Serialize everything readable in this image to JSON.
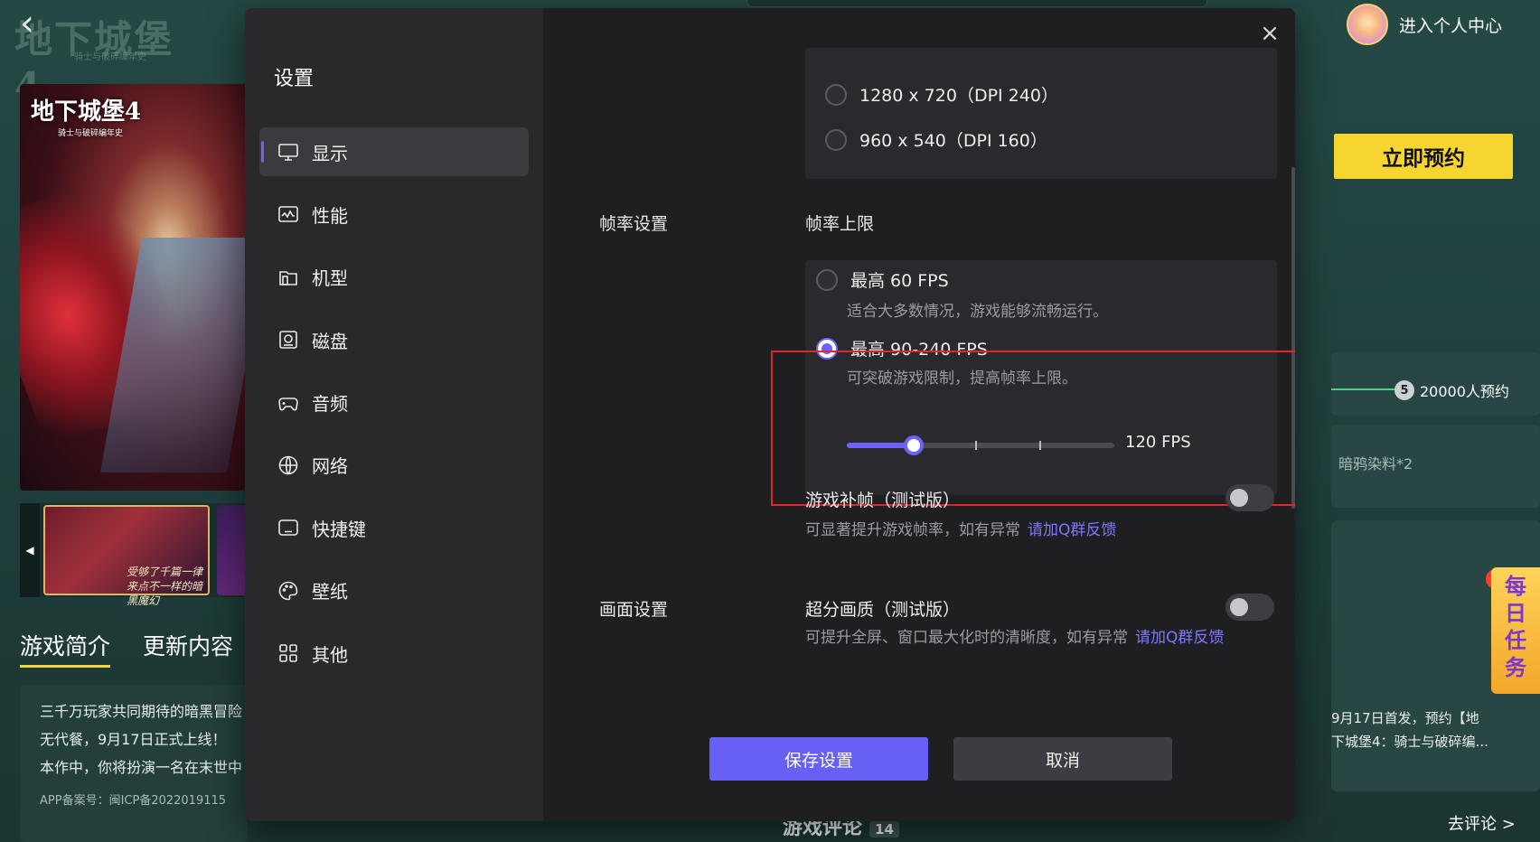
{
  "background": {
    "logo_text": "地下城堡4",
    "logo_sub": "骑士与破碎编年史",
    "hero_title": "地下城堡4",
    "hero_sub": "骑士与破碎编年史",
    "thumb_caption": "受够了千篇一律\n来点不一样的暗黑魔幻",
    "tabs": [
      "游戏简介",
      "更新内容"
    ],
    "description_lines": [
      "三千万玩家共同期待的暗黑冒险",
      "无代餐，9月17日正式上线！",
      "本作中，你将扮演一名在末世中"
    ],
    "icp": "APP备案号：闽ICP备2022019115",
    "user_center": "进入个人中心",
    "reserve_button": "立即预约",
    "progress_step_number": "5",
    "progress_step_label": "20000人预约",
    "reward_text": "暗鸦染料*2",
    "news_lines": [
      "9月17日首发，预约【地",
      "下城堡4：骑士与破碎编..."
    ],
    "comment_link": "去评论 >",
    "daily_task": "每日任务",
    "comments_title": "游戏评论",
    "comments_count": "14"
  },
  "modal": {
    "title": "设置",
    "close_glyph": "×",
    "nav": [
      {
        "label": "显示",
        "icon": "monitor-icon",
        "active": true
      },
      {
        "label": "性能",
        "icon": "performance-icon",
        "active": false
      },
      {
        "label": "机型",
        "icon": "device-model-icon",
        "active": false
      },
      {
        "label": "磁盘",
        "icon": "disk-icon",
        "active": false
      },
      {
        "label": "音频",
        "icon": "gamepad-icon",
        "active": false
      },
      {
        "label": "网络",
        "icon": "globe-icon",
        "active": false
      },
      {
        "label": "快捷键",
        "icon": "keyboard-icon",
        "active": false
      },
      {
        "label": "壁纸",
        "icon": "palette-icon",
        "active": false
      },
      {
        "label": "其他",
        "icon": "grid-icon",
        "active": false
      }
    ],
    "resolution_options": [
      {
        "label": "1280 x 720（DPI 240）",
        "checked": false
      },
      {
        "label": "960 x 540（DPI 160）",
        "checked": false
      }
    ],
    "frame_section_label": "帧率设置",
    "frame_limit_label": "帧率上限",
    "fps_options": [
      {
        "label": "最高 60 FPS",
        "desc": "适合大多数情况，游戏能够流畅运行。",
        "checked": false
      },
      {
        "label": "最高 90-240 FPS",
        "desc": "可突破游戏限制，提高帧率上限。",
        "checked": true
      }
    ],
    "fps_slider": {
      "value_label": "120 FPS",
      "fraction": 0.25
    },
    "frame_interp": {
      "title": "游戏补帧（测试版）",
      "desc": "可显著提升游戏帧率，如有异常",
      "link": "请加Q群反馈",
      "enabled": false
    },
    "display_section_label": "画面设置",
    "super_res": {
      "title": "超分画质（测试版）",
      "desc": "可提升全屏、窗口最大化时的清晰度，如有异常",
      "link": "请加Q群反馈",
      "enabled": false
    },
    "save_button": "保存设置",
    "cancel_button": "取消"
  },
  "colors": {
    "accent": "#6c63ff",
    "highlight": "#e0262b",
    "reserve": "#f6d531"
  }
}
